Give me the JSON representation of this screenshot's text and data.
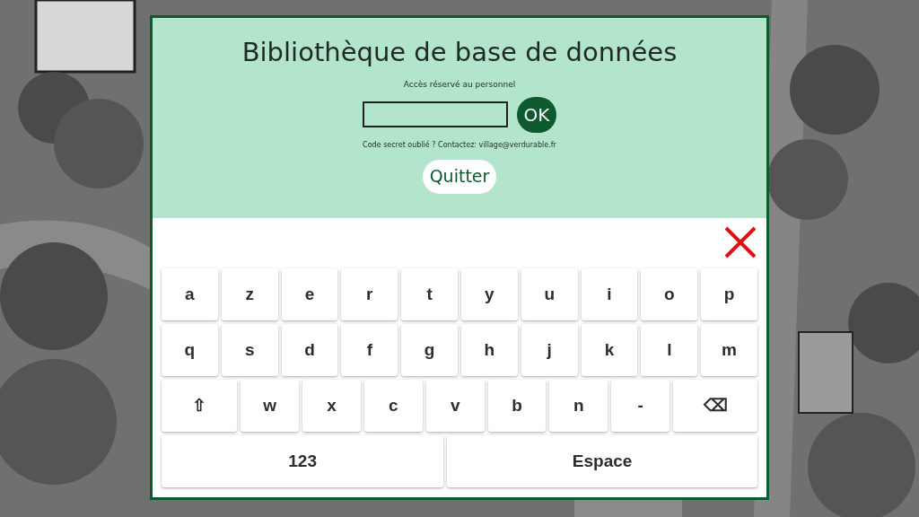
{
  "dialog": {
    "title": "Bibliothèque de base de données",
    "subtitle": "Accès réservé au personnel",
    "ok_button": "OK",
    "help_text": "Code secret oublié ? Contactez: village@verdurable.fr",
    "quit_button": "Quitter"
  },
  "keyboard": {
    "rows": [
      [
        {
          "kind": "char",
          "label": "a"
        },
        {
          "kind": "char",
          "label": "z"
        },
        {
          "kind": "char",
          "label": "e"
        },
        {
          "kind": "char",
          "label": "r"
        },
        {
          "kind": "char",
          "label": "t"
        },
        {
          "kind": "char",
          "label": "y"
        },
        {
          "kind": "char",
          "label": "u"
        },
        {
          "kind": "char",
          "label": "i"
        },
        {
          "kind": "char",
          "label": "o"
        },
        {
          "kind": "char",
          "label": "p"
        }
      ],
      [
        {
          "kind": "char",
          "label": "q"
        },
        {
          "kind": "char",
          "label": "s"
        },
        {
          "kind": "char",
          "label": "d"
        },
        {
          "kind": "char",
          "label": "f"
        },
        {
          "kind": "char",
          "label": "g"
        },
        {
          "kind": "char",
          "label": "h"
        },
        {
          "kind": "char",
          "label": "j"
        },
        {
          "kind": "char",
          "label": "k"
        },
        {
          "kind": "char",
          "label": "l"
        },
        {
          "kind": "char",
          "label": "m"
        }
      ],
      [
        {
          "kind": "shift",
          "label": "⇧"
        },
        {
          "kind": "char",
          "label": "w"
        },
        {
          "kind": "char",
          "label": "x"
        },
        {
          "kind": "char",
          "label": "c"
        },
        {
          "kind": "char",
          "label": "v"
        },
        {
          "kind": "char",
          "label": "b"
        },
        {
          "kind": "char",
          "label": "n"
        },
        {
          "kind": "char",
          "label": "-"
        },
        {
          "kind": "backspace",
          "label": "⌫"
        }
      ]
    ],
    "numbers_key": "123",
    "space_key": "Espace"
  }
}
